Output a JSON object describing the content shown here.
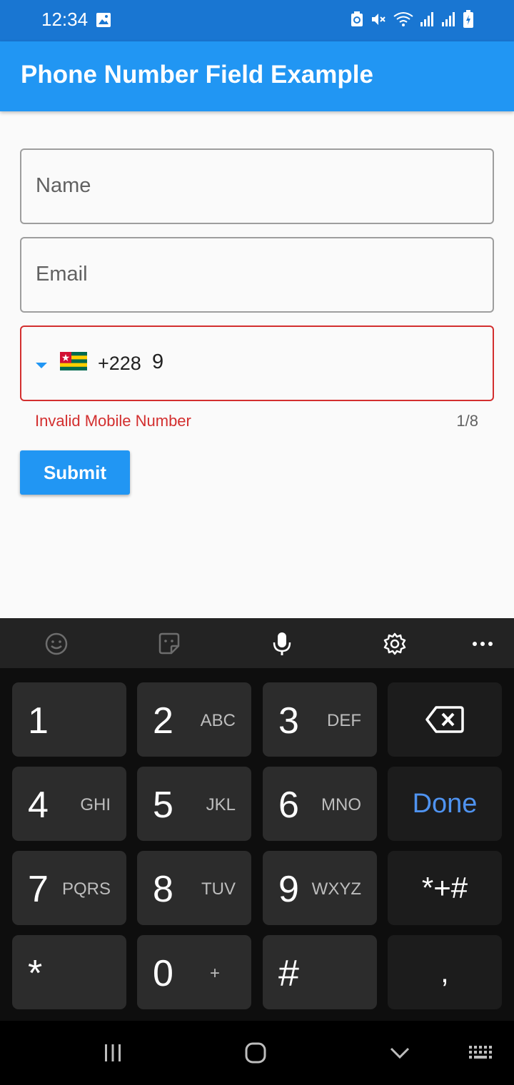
{
  "status_bar": {
    "time": "12:34",
    "icons": [
      "gallery-icon",
      "sync-icon",
      "mute-icon",
      "wifi-icon",
      "signal-icon",
      "signal-icon",
      "battery-charging-icon"
    ]
  },
  "app_bar": {
    "title": "Phone Number Field Example"
  },
  "form": {
    "name_placeholder": "Name",
    "email_placeholder": "Email",
    "phone": {
      "country_flag": "togo-flag",
      "dial_code": "+228",
      "value": "9",
      "error": "Invalid Mobile Number",
      "counter": "1/8"
    },
    "submit_label": "Submit"
  },
  "keyboard": {
    "toolbar": [
      "emoji-icon",
      "sticker-icon",
      "microphone-icon",
      "settings-gear-icon",
      "more-icon"
    ],
    "rows": [
      [
        {
          "digit": "1",
          "letters": ""
        },
        {
          "digit": "2",
          "letters": "ABC"
        },
        {
          "digit": "3",
          "letters": "DEF"
        },
        {
          "action": "backspace-icon"
        }
      ],
      [
        {
          "digit": "4",
          "letters": "GHI"
        },
        {
          "digit": "5",
          "letters": "JKL"
        },
        {
          "digit": "6",
          "letters": "MNO"
        },
        {
          "label": "Done"
        }
      ],
      [
        {
          "digit": "7",
          "letters": "PQRS"
        },
        {
          "digit": "8",
          "letters": "TUV"
        },
        {
          "digit": "9",
          "letters": "WXYZ"
        },
        {
          "label": "*+#"
        }
      ],
      [
        {
          "label": "*"
        },
        {
          "digit": "0",
          "letters": "+"
        },
        {
          "label": "#"
        },
        {
          "label": ","
        }
      ]
    ]
  },
  "nav_bar": [
    "recent-apps-icon",
    "home-icon",
    "back-chevron-icon",
    "keyboard-switch-icon"
  ],
  "colors": {
    "status_bar": "#1976d2",
    "app_bar": "#2196f3",
    "error": "#d32f2f",
    "done": "#4f93f0"
  }
}
